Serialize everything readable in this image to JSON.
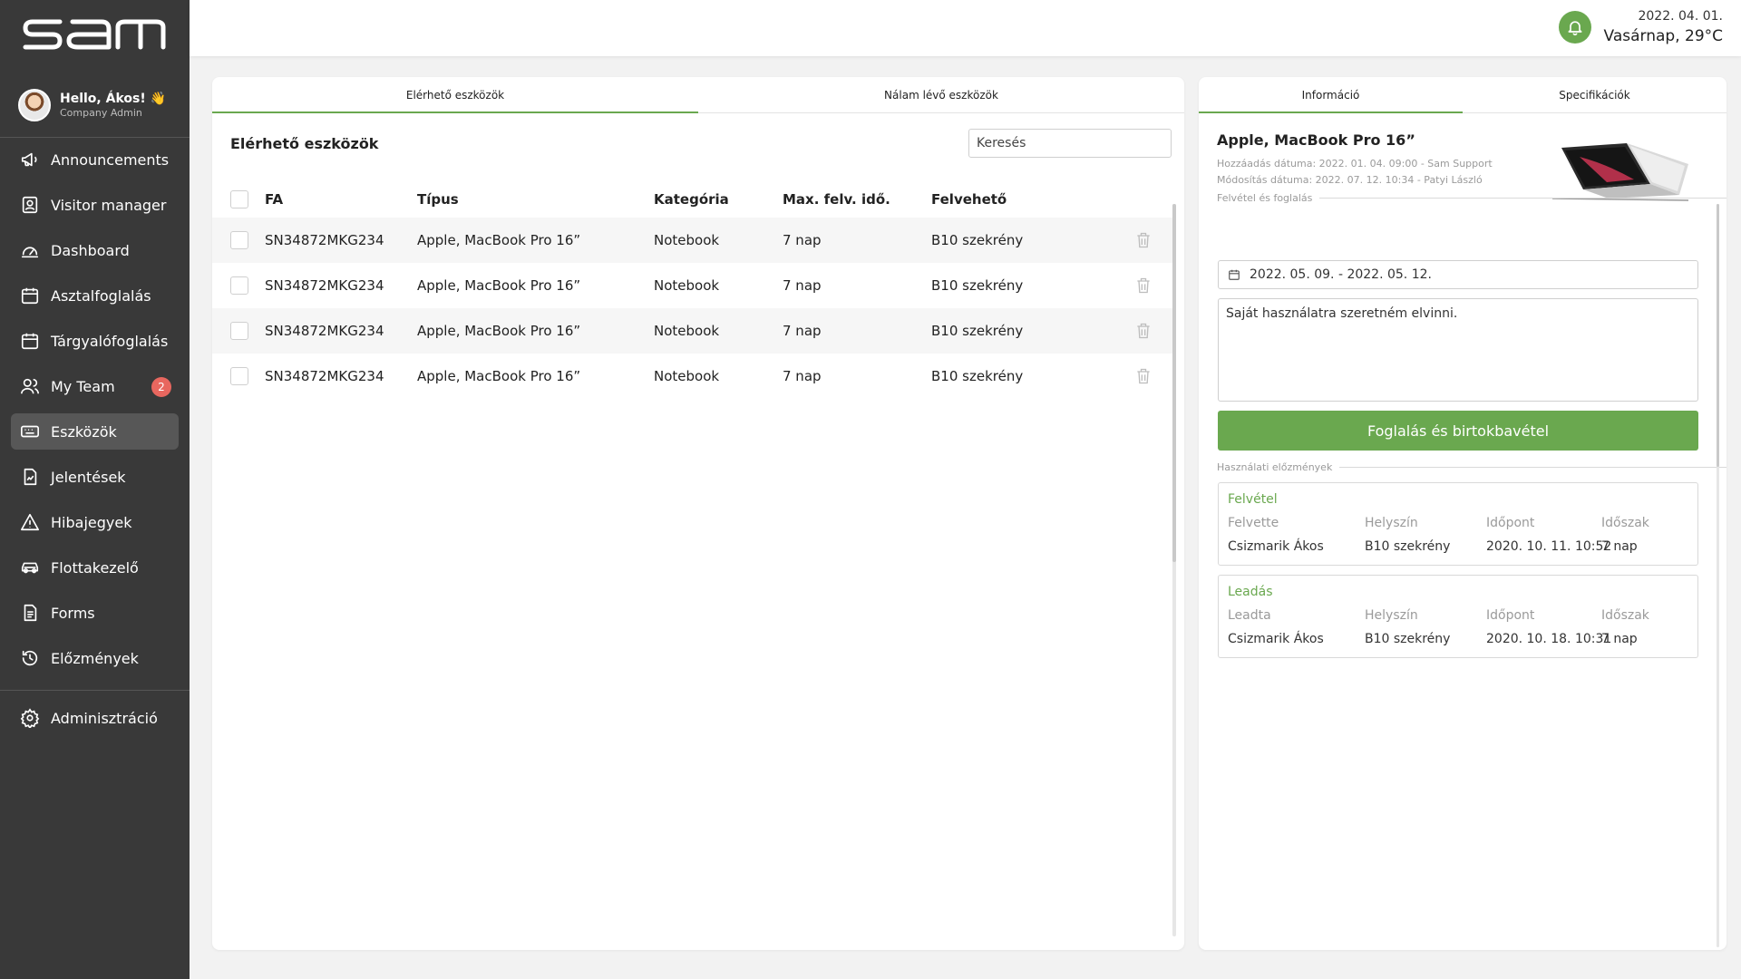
{
  "sidebar": {
    "logo_text": "sam",
    "user": {
      "greeting": "Hello, Ákos! 👋",
      "role": "Company Admin"
    },
    "items": [
      {
        "label": "Announcements",
        "icon": "megaphone-icon"
      },
      {
        "label": "Visitor manager",
        "icon": "visitor-badge-icon"
      },
      {
        "label": "Dashboard",
        "icon": "gauge-icon"
      },
      {
        "label": "Asztalfoglalás",
        "icon": "calendar-icon"
      },
      {
        "label": "Tárgyalófoglalás",
        "icon": "calendar-icon"
      },
      {
        "label": "My Team",
        "icon": "team-icon",
        "badge": "2"
      },
      {
        "label": "Eszközök",
        "icon": "keyboard-icon",
        "active": true
      },
      {
        "label": "Jelentések",
        "icon": "report-icon"
      },
      {
        "label": "Hibajegyek",
        "icon": "warning-icon"
      },
      {
        "label": "Flottakezelő",
        "icon": "car-icon"
      },
      {
        "label": "Forms",
        "icon": "document-icon"
      },
      {
        "label": "Előzmények",
        "icon": "history-icon"
      }
    ],
    "admin": {
      "label": "Adminisztráció",
      "icon": "gear-icon"
    }
  },
  "header": {
    "date": "2022. 04. 01.",
    "weather": "Vasárnap, 29°C",
    "accent": "#6aa84f"
  },
  "left_panel": {
    "tabs": [
      "Elérhető eszközök",
      "Nálam lévő eszközök"
    ],
    "title": "Elérhető eszközök",
    "search_placeholder": "Keresés",
    "columns": [
      "FA",
      "Típus",
      "Kategória",
      "Max. felv. idő.",
      "Felvehető"
    ],
    "rows": [
      {
        "fa": "SN34872MKG234",
        "type": "Apple, MacBook Pro 16”",
        "category": "Notebook",
        "max": "7 nap",
        "location": "B10 szekrény"
      },
      {
        "fa": "SN34872MKG234",
        "type": "Apple, MacBook Pro 16”",
        "category": "Notebook",
        "max": "7 nap",
        "location": "B10 szekrény"
      },
      {
        "fa": "SN34872MKG234",
        "type": "Apple, MacBook Pro 16”",
        "category": "Notebook",
        "max": "7 nap",
        "location": "B10 szekrény"
      },
      {
        "fa": "SN34872MKG234",
        "type": "Apple, MacBook Pro 16”",
        "category": "Notebook",
        "max": "7 nap",
        "location": "B10 szekrény"
      }
    ]
  },
  "right_panel": {
    "tabs": [
      "Információ",
      "Specifikációk"
    ],
    "title": "Apple, MacBook Pro 16”",
    "added": "Hozzáadás dátuma: 2022. 01. 04. 09:00 - Sam Support",
    "modified": "Módosítás dátuma: 2022. 07. 12. 10:34 - Patyi László",
    "reserve_section": "Felvétel és foglalás",
    "date_range": "2022. 05. 09. - 2022. 05. 12.",
    "note": "Saját használatra szeretném elvinni.",
    "button": "Foglalás és birtokbavétel",
    "history_section": "Használati előzmények",
    "history": [
      {
        "title": "Felvétel",
        "headers": [
          "Felvette",
          "Helyszín",
          "Időpont",
          "Időszak"
        ],
        "values": [
          "Csizmarik Ákos",
          "B10 szekrény",
          "2020. 10. 11. 10:52",
          "7 nap"
        ]
      },
      {
        "title": "Leadás",
        "headers": [
          "Leadta",
          "Helyszín",
          "Időpont",
          "Időszak"
        ],
        "values": [
          "Csizmarik Ákos",
          "B10 szekrény",
          "2020. 10. 18. 10:31",
          "7 nap"
        ]
      }
    ]
  }
}
